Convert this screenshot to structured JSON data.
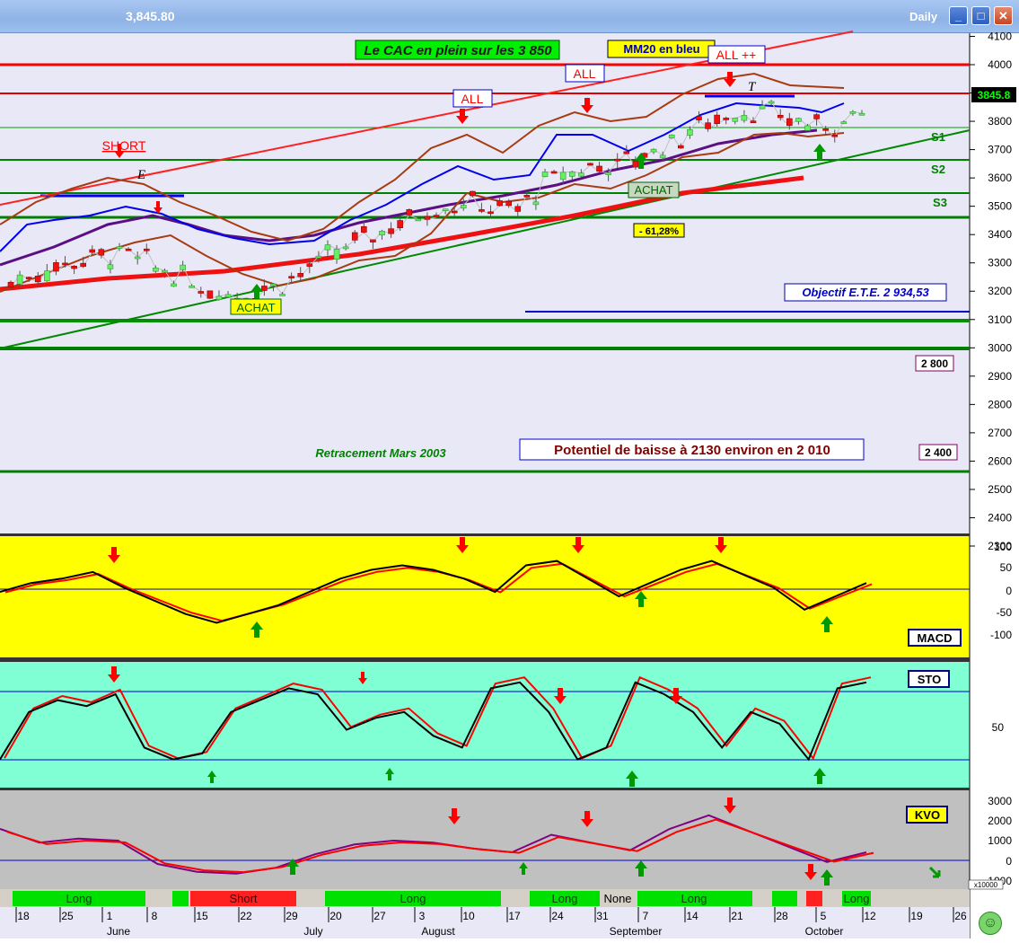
{
  "window": {
    "price_label": "3,845.80",
    "period": "Daily",
    "buttons": [
      "_",
      "□",
      "✕"
    ]
  },
  "price_panel": {
    "y_ticks": [
      "4100",
      "4000",
      "3900",
      "3800",
      "3700",
      "3600",
      "3500",
      "3400",
      "3300",
      "3200",
      "3100",
      "3000",
      "2900",
      "2800",
      "2700",
      "2600",
      "2500",
      "2400",
      "2300"
    ],
    "last_price": "3845.8",
    "labels": {
      "headline": "Le CAC en plein sur les 3 850",
      "mm20": "MM20 en bleu",
      "all1": "ALL",
      "all2": "ALL",
      "all3": "ALL ++",
      "short": "SHORT",
      "achat1": "ACHAT",
      "achat2": "ACHAT",
      "fib": "- 61,28%",
      "objectif": "Objectif E.T.E. 2 934,53",
      "potentiel": "Potentiel de baisse à 2130 environ en 2 010",
      "retracement": "Retracement Mars 2003",
      "lvl2800": "2 800",
      "lvl2400": "2 400",
      "s1": "S1",
      "s2": "S2",
      "s3": "S3",
      "e": "E",
      "t": "T"
    }
  },
  "macd_panel": {
    "label": "MACD",
    "y_ticks": [
      "100",
      "50",
      "0",
      "-50",
      "-100"
    ]
  },
  "sto_panel": {
    "label": "STO",
    "y_ticks": [
      "50"
    ]
  },
  "kvo_panel": {
    "label": "KVO",
    "y_ticks": [
      "3000",
      "2000",
      "1000",
      "0",
      "-1000"
    ],
    "scale": "x10000"
  },
  "signal_bar": [
    "Long",
    "Short",
    "Long",
    "Long",
    "None",
    "Long",
    "Long"
  ],
  "x_axis": {
    "days": [
      "18",
      "25",
      "1",
      "8",
      "15",
      "22",
      "29",
      "20",
      "27",
      "3",
      "10",
      "17",
      "24",
      "31",
      "7",
      "14",
      "21",
      "28",
      "5",
      "12",
      "19",
      "26"
    ],
    "months": [
      "June",
      "July",
      "August",
      "September",
      "October"
    ]
  },
  "colors": {
    "price_bg": "#e8e8f7",
    "macd_bg": "#ffff00",
    "sto_bg": "#80ffd4",
    "kvo_bg": "#c0c0c0",
    "long": "#00e000",
    "short": "#ff2020",
    "signal_red": "#ff0000",
    "signal_green": "#009900"
  },
  "chart_data": [
    {
      "type": "line",
      "title": "",
      "series": [
        {
          "name": "MM20 en bleu",
          "values": [
            3230,
            3280,
            3320,
            3330,
            3270,
            3210,
            3190,
            3230,
            3300,
            3380,
            3440,
            3500,
            3510,
            3480,
            3600,
            3640,
            3660,
            3720,
            3800,
            3840,
            3810,
            3780,
            3830
          ]
        }
      ],
      "x": [
        "18",
        "25",
        "1",
        "8",
        "15",
        "22",
        "29",
        "20",
        "27",
        "3",
        "10",
        "17",
        "24",
        "31",
        "7",
        "14",
        "21",
        "28",
        "5",
        "12"
      ],
      "ylim": [
        2200,
        4150
      ],
      "horizontal_lines": [
        4000,
        3850,
        3700,
        3550,
        3400,
        3300,
        2900,
        2800,
        2400
      ],
      "last": 3845.8
    },
    {
      "type": "line",
      "title": "MACD",
      "ylim": [
        -130,
        130
      ],
      "series": [
        {
          "name": "MACD",
          "values": [
            10,
            30,
            40,
            55,
            20,
            -10,
            -40,
            -60,
            -40,
            -20,
            10,
            40,
            60,
            70,
            60,
            40,
            10,
            70,
            80,
            40,
            0,
            30,
            60,
            80,
            50,
            20,
            -30,
            0,
            30
          ]
        }
      ]
    },
    {
      "type": "line",
      "title": "STO",
      "ylim": [
        0,
        100
      ],
      "series": [
        {
          "name": "STO",
          "values": [
            20,
            60,
            70,
            65,
            75,
            30,
            20,
            25,
            60,
            70,
            80,
            75,
            45,
            55,
            60,
            40,
            30,
            80,
            85,
            60,
            20,
            30,
            85,
            75,
            60,
            30,
            60,
            50,
            20,
            80,
            85
          ]
        }
      ]
    },
    {
      "type": "line",
      "title": "KVO",
      "ylim": [
        -1500,
        3300
      ],
      "series": [
        {
          "name": "KVO",
          "values": [
            1500,
            800,
            1000,
            900,
            -300,
            -700,
            -800,
            -500,
            200,
            700,
            900,
            800,
            500,
            300,
            1200,
            800,
            400,
            1500,
            2200,
            1400,
            600,
            -200,
            300
          ]
        }
      ]
    }
  ]
}
